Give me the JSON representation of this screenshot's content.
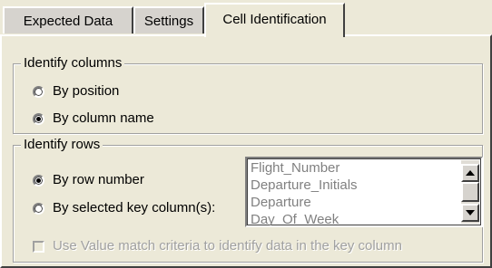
{
  "tabs": [
    {
      "label": "Expected Data",
      "active": false
    },
    {
      "label": "Settings",
      "active": false
    },
    {
      "label": "Cell Identification",
      "active": true
    }
  ],
  "identify_columns": {
    "legend": "Identify columns",
    "options": [
      {
        "label": "By position",
        "selected": false
      },
      {
        "label": "By column name",
        "selected": true
      }
    ]
  },
  "identify_rows": {
    "legend": "Identify rows",
    "options": [
      {
        "label": "By row number",
        "selected": true
      },
      {
        "label": "By selected key column(s):",
        "selected": false
      }
    ],
    "key_columns": [
      "Flight_Number",
      "Departure_Initials",
      "Departure",
      "Day_Of_Week"
    ],
    "value_match_checkbox": {
      "label": "Use Value match criteria to identify data in the key column",
      "checked": false,
      "enabled": false
    }
  },
  "icons": {
    "scroll_up": "scroll-up-arrow-icon",
    "scroll_down": "scroll-down-arrow-icon"
  }
}
